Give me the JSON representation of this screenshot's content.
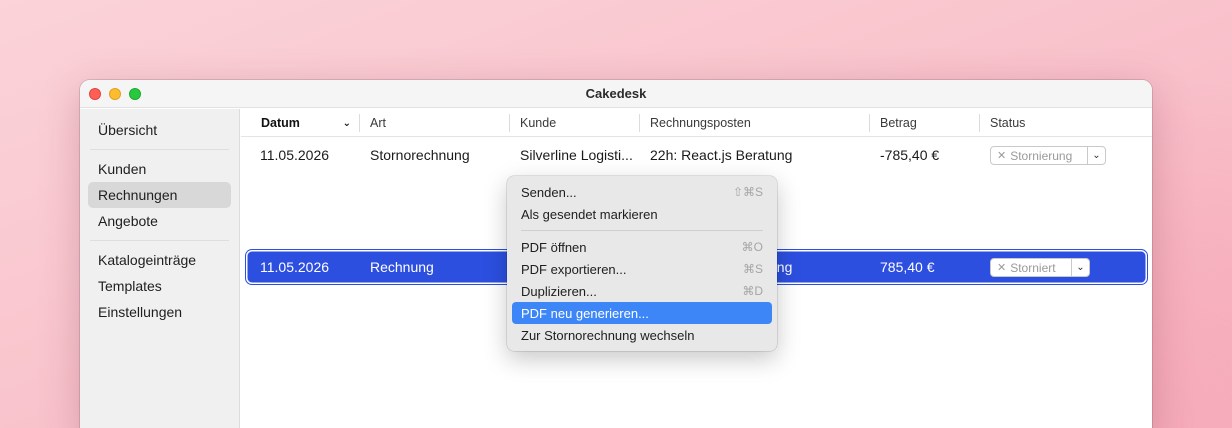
{
  "window": {
    "title": "Cakedesk"
  },
  "sidebar": {
    "groups": [
      [
        {
          "label": "Übersicht"
        }
      ],
      [
        {
          "label": "Kunden"
        },
        {
          "label": "Rechnungen",
          "active": true
        },
        {
          "label": "Angebote"
        }
      ],
      [
        {
          "label": "Katalogeinträge"
        },
        {
          "label": "Templates"
        },
        {
          "label": "Einstellungen"
        }
      ]
    ]
  },
  "table": {
    "columns": [
      "Datum",
      "Art",
      "Kunde",
      "Rechnungsposten",
      "Betrag",
      "Status"
    ],
    "sorted_column": "Datum",
    "rows": [
      {
        "datum": "11.05.2026",
        "art": "Stornorechnung",
        "kunde": "Silverline Logisti...",
        "posten": "22h: React.js Beratung",
        "betrag": "-785,40 €",
        "status": "Stornierung",
        "selected": false
      },
      {
        "datum": "11.05.2026",
        "art": "Rechnung",
        "kunde": "",
        "posten": "ung",
        "betrag": "785,40 €",
        "status": "Storniert",
        "selected": true
      }
    ]
  },
  "context_menu": {
    "items": [
      {
        "label": "Senden...",
        "shortcut": "⇧⌘S"
      },
      {
        "label": "Als gesendet markieren",
        "shortcut": ""
      },
      {
        "separator": true
      },
      {
        "label": "PDF öffnen",
        "shortcut": "⌘O"
      },
      {
        "label": "PDF exportieren...",
        "shortcut": "⌘S"
      },
      {
        "label": "Duplizieren...",
        "shortcut": "⌘D"
      },
      {
        "label": "PDF neu generieren...",
        "shortcut": "",
        "highlighted": true
      },
      {
        "label": "Zur Stornorechnung wechseln",
        "shortcut": ""
      }
    ]
  },
  "colors": {
    "selection": "#2c4fe0",
    "menu_highlight": "#3d86f7"
  }
}
